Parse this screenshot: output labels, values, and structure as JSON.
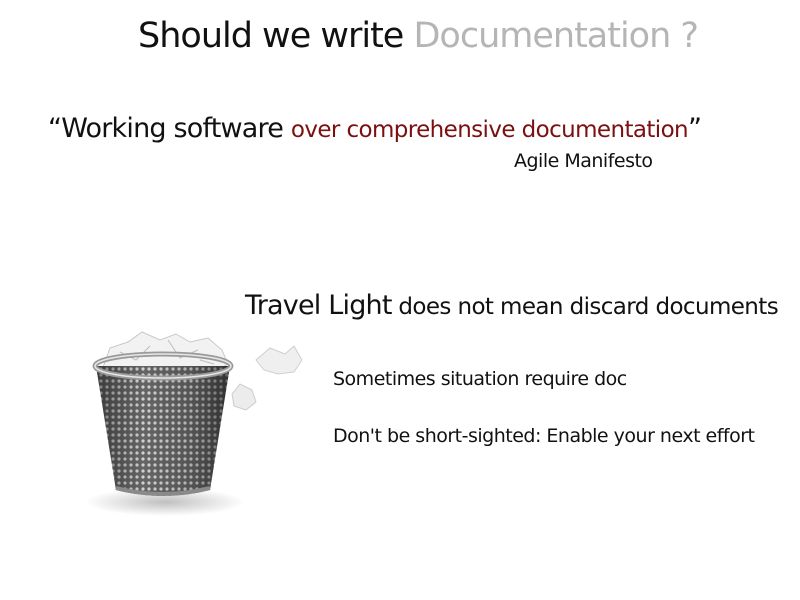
{
  "title": {
    "part1": "Should we write ",
    "part2": "Documentation ?"
  },
  "quote": {
    "open": "“",
    "text1": "Working software ",
    "text2": "over comprehensive documentation",
    "close": "”",
    "attribution": "Agile Manifesto"
  },
  "travel": {
    "part1": "Travel Light",
    "part2": " does not mean discard documents"
  },
  "points": [
    "Sometimes situation require doc",
    "Don't be short-sighted: Enable your next effort"
  ],
  "image": {
    "icon": "wastebasket-with-crumpled-paper-icon"
  },
  "colors": {
    "text": "#111111",
    "title_grey": "#b5b5b5",
    "accent_red": "#7a1010"
  }
}
